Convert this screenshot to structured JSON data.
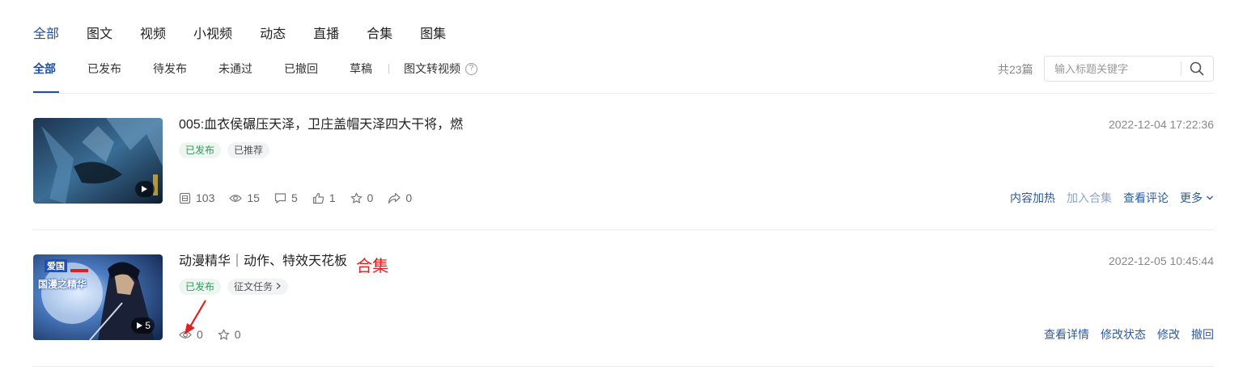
{
  "tabs_top": [
    "全部",
    "图文",
    "视频",
    "小视频",
    "动态",
    "直播",
    "合集",
    "图集"
  ],
  "tabs_sub": [
    "全部",
    "已发布",
    "待发布",
    "未通过",
    "已撤回",
    "草稿"
  ],
  "convert_tab": "图文转视频",
  "help_glyph": "?",
  "count_text": "共23篇",
  "search": {
    "placeholder": "输入标题关键字",
    "icon": "search-icon"
  },
  "items": [
    {
      "title": "005:血衣侯碾压天泽，卫庄盖帽天泽四大干将，燃",
      "date": "2022-12-04 17:22:36",
      "tags": [
        "已发布",
        "已推荐"
      ],
      "stats": {
        "impressions": "103",
        "views": "15",
        "comments": "5",
        "likes": "1",
        "favorites": "0",
        "shares": "0"
      },
      "actions": [
        "内容加热",
        "加入合集",
        "查看评论",
        "更多"
      ],
      "badge": ""
    },
    {
      "title": "动漫精华｜动作、特效天花板",
      "annotation": "合集",
      "date": "2022-12-05 10:45:44",
      "tags": [
        "已发布",
        "征文任务"
      ],
      "stats": {
        "views": "0",
        "favorites": "0"
      },
      "actions": [
        "查看详情",
        "修改状态",
        "修改",
        "撤回"
      ],
      "badge": "5",
      "thumb_text": [
        "爱国",
        "国漫之精华"
      ]
    }
  ],
  "colors": {
    "accent": "#1f4fa0",
    "link": "#2c5aa0",
    "published": "#2f9a5a",
    "annotation": "#e02020"
  }
}
